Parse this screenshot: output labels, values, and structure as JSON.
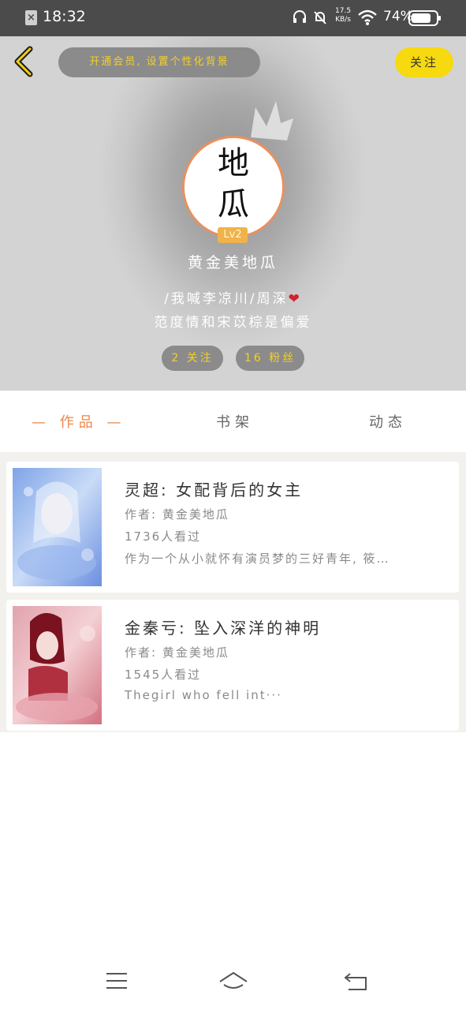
{
  "status_bar": {
    "time": "18:32",
    "net_speed_value": "17.5",
    "net_speed_unit": "KB/s",
    "battery": "74%"
  },
  "header": {
    "vip_banner": "开通会员, 设置个性化背景",
    "follow_label": "关注",
    "avatar_text": "地\n瓜",
    "level": "Lv2",
    "username": "黄金美地瓜",
    "bio_line1": "/我喊李凉川/周深",
    "bio_line2": "范度情和宋苡棕是偏爱",
    "following_label": "2 关注",
    "fans_label": "16 粉丝"
  },
  "tabs": [
    {
      "label": "— 作品 —",
      "active": true
    },
    {
      "label": "书架",
      "active": false
    },
    {
      "label": "动态",
      "active": false
    }
  ],
  "works": [
    {
      "title": "灵超: 女配背后的女主",
      "author": "作者: 黄金美地瓜",
      "views": "1736人看过",
      "summary": "作为一个从小就怀有演员梦的三好青年, 筱…"
    },
    {
      "title": "金秦亏: 坠入深洋的神明",
      "author": "作者: 黄金美地瓜",
      "views": "1545人看过",
      "summary": "Thegirl who fell int···"
    }
  ],
  "colors": {
    "accent": "#e9874a",
    "follow_yellow": "#f6d90f",
    "vip_text": "#f2cf2e",
    "header_bg": "#b3b3b3"
  },
  "icons": {
    "back": "chevron-left-icon",
    "crown": "crown-icon",
    "heart": "two-hearts-icon",
    "nav_menu": "menu-icon",
    "nav_home": "home-icon",
    "nav_back": "return-icon"
  }
}
